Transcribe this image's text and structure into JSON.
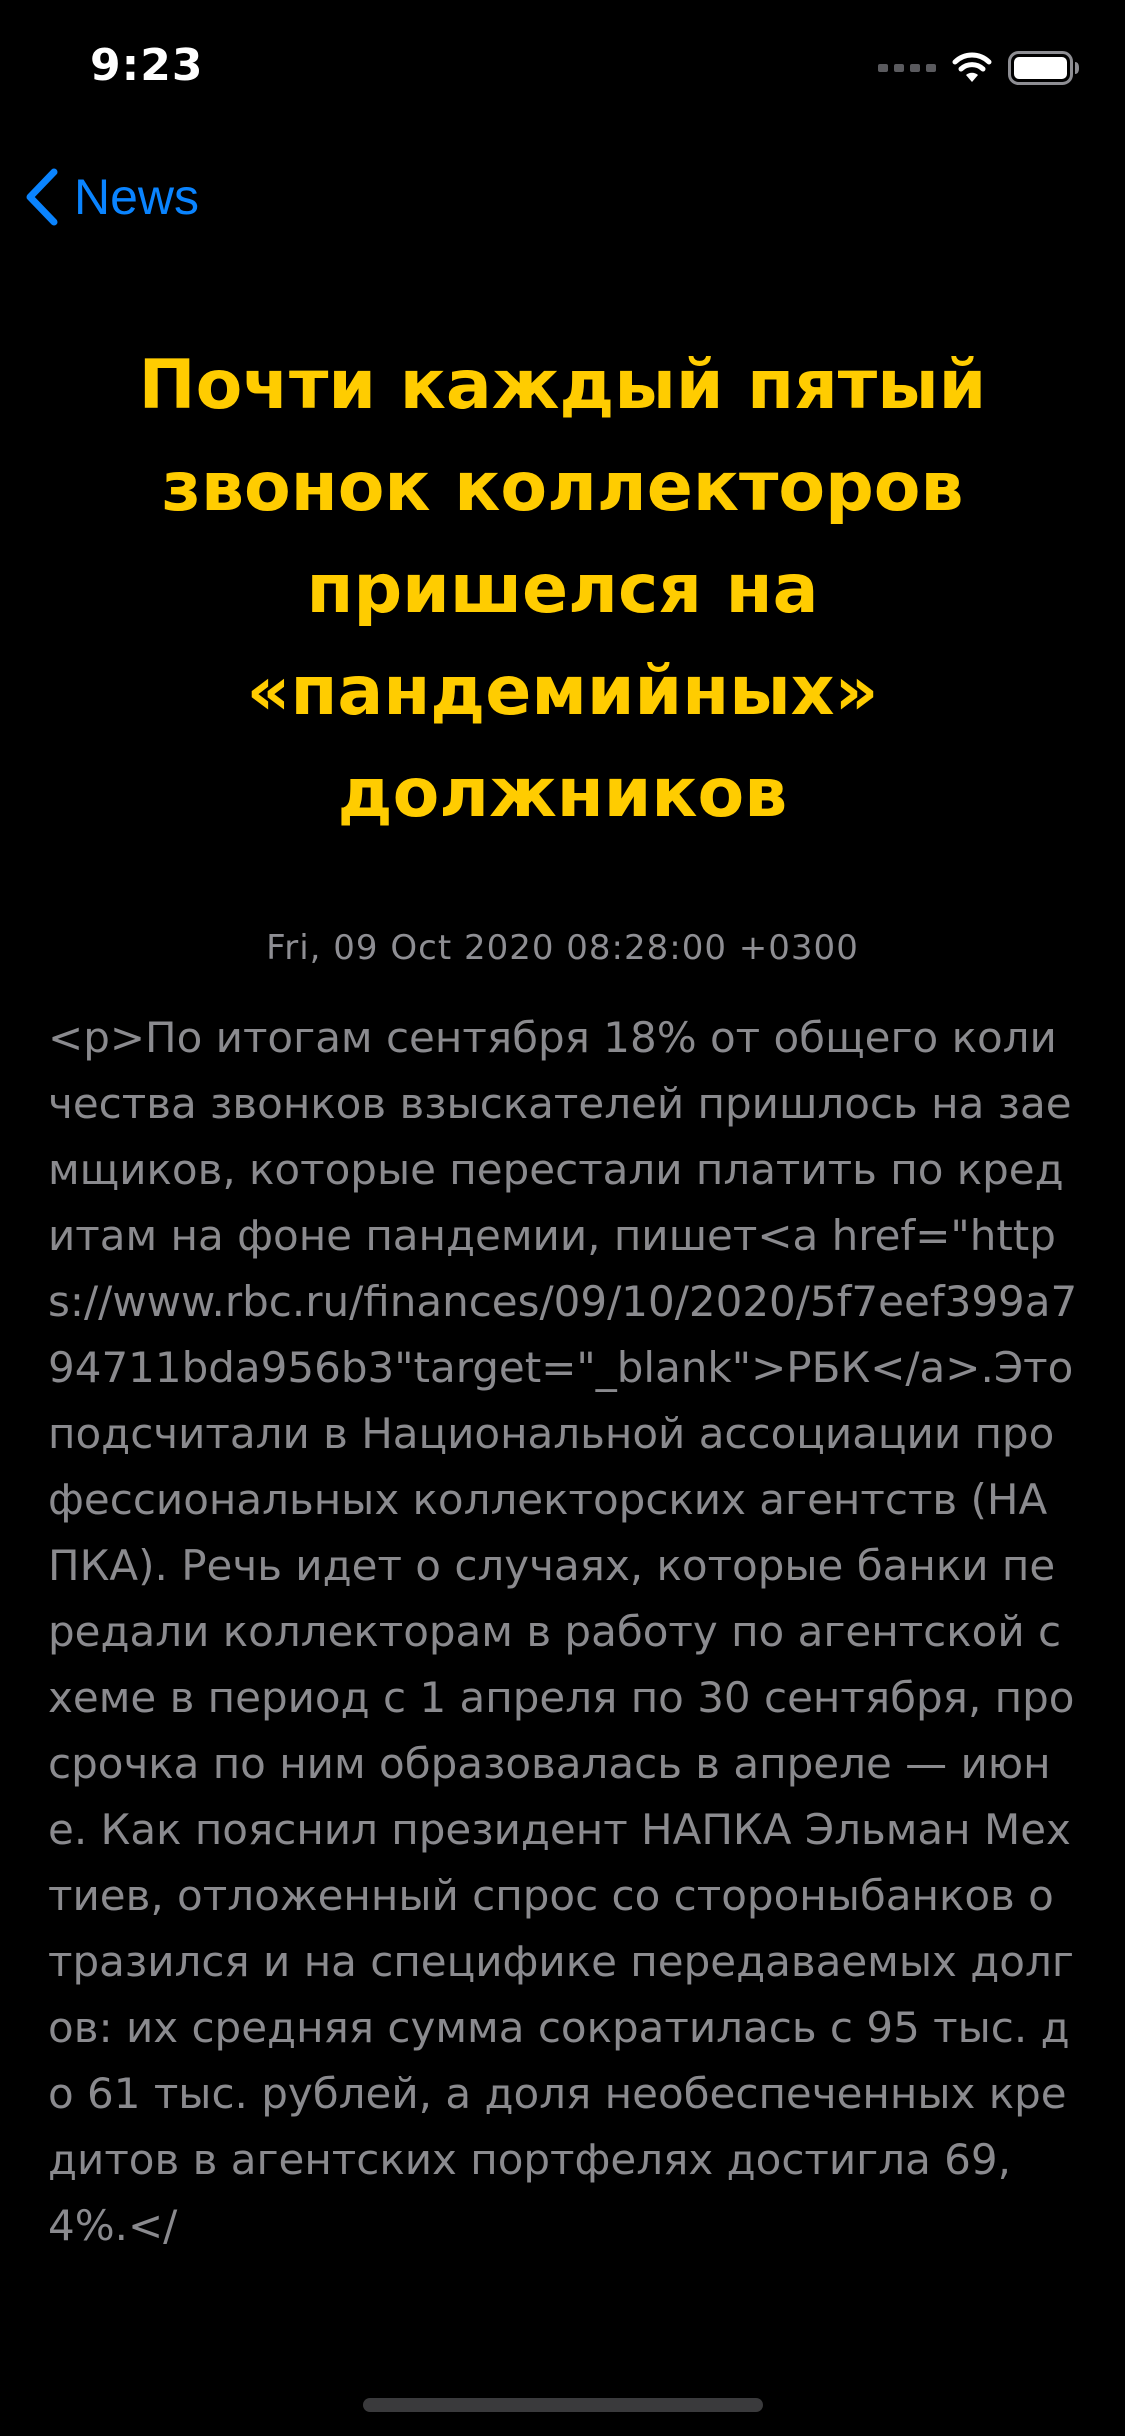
{
  "status_bar": {
    "time": "9:23"
  },
  "nav": {
    "back_label": "News"
  },
  "article": {
    "title": "Почти каждый пятый звонок коллекторов пришелся на «пандемийных» должников",
    "date": "Fri, 09 Oct 2020 08:28:00 +0300",
    "body": "<p>По итогам сентября 18% от общего количества звонков взыскателей пришлось на заемщиков, которые перестали платить по кредитам на фоне пандемии, пишет<a href=\"https://www.rbc.ru/finances/09/10/2020/5f7eef399a794711bda956b3\"target=\"_blank\">РБК</a>.Это подсчитали в Национальной ассоциации профессиональных коллекторских агентств (НАПКА). Речь идет о случаях, которые банки передали коллекторам в работу по агентской схеме в период с 1 апреля по 30 сентября, просрочка по ним образовалась в апреле — июне. Как пояснил президент НАПКА Эльман Мехтиев, отложенный спрос со стороныбанков отразился и на специфике передаваемых долгов: их средняя сумма сократилась с 95 тыс. до 61 тыс. рублей, а доля необеспеченных кредитов в агентских портфелях достигла 69,4%.</"
  },
  "colors": {
    "background": "#000000",
    "title": "#ffcc00",
    "body_text": "#8a8a8e",
    "date_text": "#8e8e93",
    "accent": "#0a84ff"
  },
  "icons": {
    "back": "chevron-left-icon",
    "signal": "cellular-signal-icon",
    "wifi": "wifi-icon",
    "battery": "battery-icon"
  }
}
